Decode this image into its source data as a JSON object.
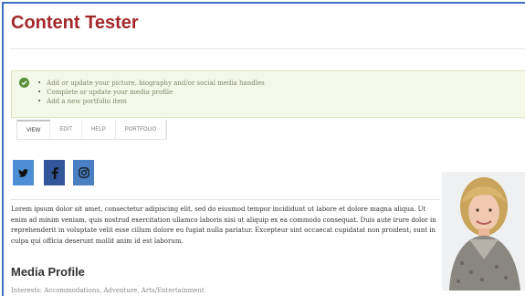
{
  "page": {
    "title": "Content Tester"
  },
  "notice": {
    "items": [
      "Add or update your picture, biography and/or social media handles",
      "Complete or update your media profile",
      "Add a new portfolio item"
    ]
  },
  "tabs": [
    {
      "label": "VIEW",
      "active": true
    },
    {
      "label": "EDIT",
      "active": false
    },
    {
      "label": "HELP",
      "active": false
    },
    {
      "label": "PORTFOLIO",
      "active": false
    }
  ],
  "social": [
    {
      "name": "twitter",
      "glyph": "🐦",
      "icon": "twitter-icon",
      "color": "#4c8fd6"
    },
    {
      "name": "facebook",
      "glyph": "f",
      "icon": "facebook-icon",
      "color": "#32569a"
    },
    {
      "name": "instagram",
      "glyph": "◎",
      "icon": "instagram-icon",
      "color": "#4a7fc2"
    }
  ],
  "bio": "Lorem ipsum dolor sit amet, consectetur adipiscing elit, sed do eiusmod tempor incididunt ut labore et dolore magna aliqua. Ut enim ad minim veniam, quis nostrud exercitation ullamco laboris nisi ut aliquip ex ea commodo consequat. Duis aute irure dolor in reprehenderit in voluptate velit esse cillum dolore eu fugiat nulla pariatur. Excepteur sint occaecat cupidatat non proident, sunt in culpa qui officia deserunt mollit anim id est laborum.",
  "media_profile": {
    "heading": "Media Profile",
    "interests": "Interests: Accommodations, Adventure, Arts/Entertainment"
  },
  "colors": {
    "title": "#a3282a",
    "frame_border": "#3b6fc4",
    "notice_bg": "#f4f8e8",
    "check": "#5a8f3a"
  }
}
